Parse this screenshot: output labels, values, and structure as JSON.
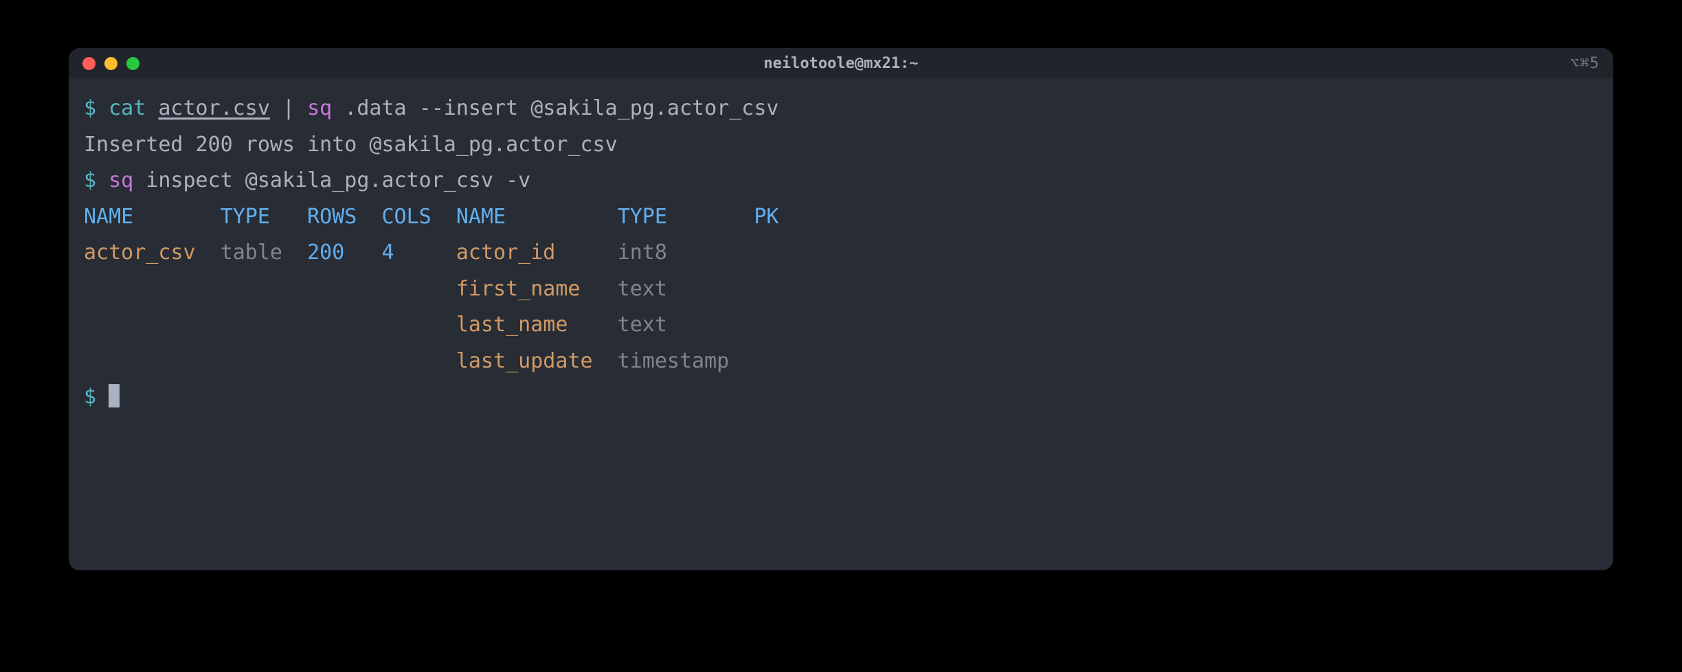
{
  "window": {
    "title": "neilotoole@mx21:~",
    "shortcut_hint": "⌥⌘5"
  },
  "lines": {
    "l1": {
      "prompt": "$",
      "cat": "cat",
      "file": "actor.csv",
      "pipe": " | ",
      "sq": "sq",
      "rest": " .data --insert @sakila_pg.actor_csv"
    },
    "l2": "Inserted 200 rows into @sakila_pg.actor_csv",
    "l3": {
      "prompt": "$",
      "sq": "sq",
      "rest": " inspect @sakila_pg.actor_csv -v"
    },
    "headers": {
      "name1": "NAME",
      "type1": "TYPE",
      "rows": "ROWS",
      "cols": "COLS",
      "name2": "NAME",
      "type2": "TYPE",
      "pk": "PK"
    },
    "row": {
      "name": "actor_csv",
      "type": "table",
      "rows": "200",
      "cols": "4"
    },
    "columns": [
      {
        "name": "actor_id",
        "type": "int8"
      },
      {
        "name": "first_name",
        "type": "text"
      },
      {
        "name": "last_name",
        "type": "text"
      },
      {
        "name": "last_update",
        "type": "timestamp"
      }
    ],
    "final_prompt": "$"
  }
}
